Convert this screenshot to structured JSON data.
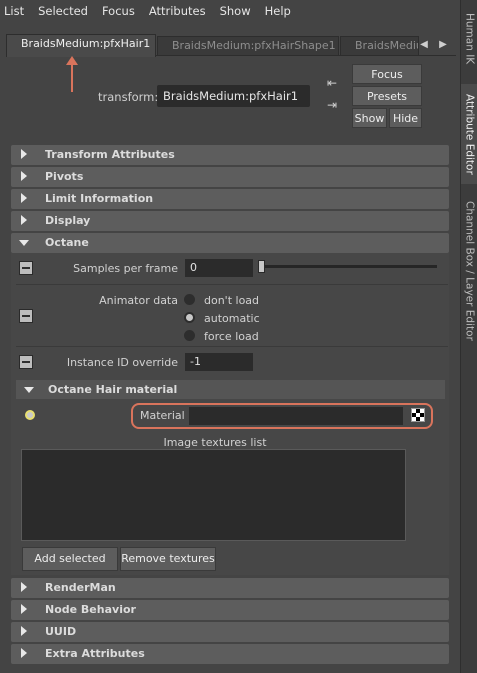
{
  "menu": [
    "List",
    "Selected",
    "Focus",
    "Attributes",
    "Show",
    "Help"
  ],
  "side_tabs": [
    "Human IK",
    "Attribute Editor",
    "Channel Box / Layer Editor"
  ],
  "node_tabs": [
    "BraidsMedium:pfxHair1",
    "BraidsMedium:pfxHairShape1",
    "BraidsMediu"
  ],
  "transform": {
    "label": "transform:",
    "value": "BraidsMedium:pfxHair1"
  },
  "buttons": {
    "focus": "Focus",
    "presets": "Presets",
    "show": "Show",
    "hide": "Hide"
  },
  "sections_top": [
    "Transform Attributes",
    "Pivots",
    "Limit Information",
    "Display",
    "Octane"
  ],
  "octane": {
    "samples_label": "Samples per frame",
    "samples_value": "0",
    "animator_label": "Animator data",
    "radio_options": [
      "don't load",
      "automatic",
      "force load"
    ],
    "radio_selected": "automatic",
    "instance_label": "Instance ID override",
    "instance_value": "-1"
  },
  "hair_material": {
    "header": "Octane Hair material",
    "material_label": "Material",
    "image_textures_label": "Image textures list",
    "add_selected": "Add selected",
    "remove_textures": "Remove textures"
  },
  "sections_bottom": [
    "RenderMan",
    "Node Behavior",
    "UUID",
    "Extra Attributes"
  ],
  "colors": {
    "highlight": "#d9745c",
    "panel": "#444444",
    "header": "#5d5d5d",
    "field": "#2b2b2b"
  }
}
